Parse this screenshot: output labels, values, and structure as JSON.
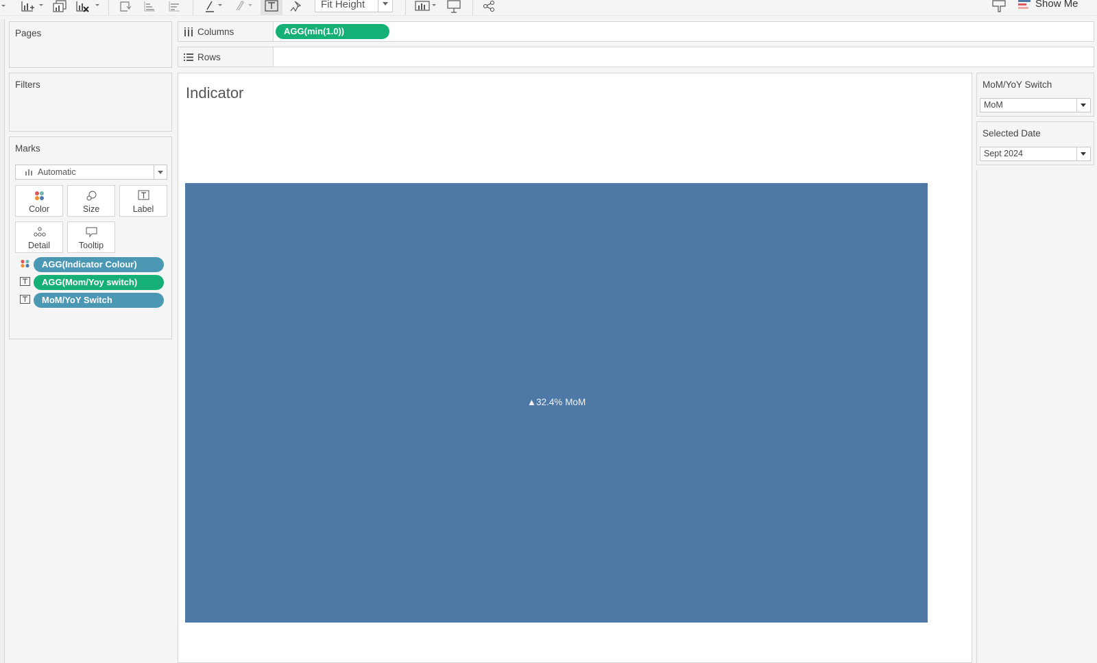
{
  "toolbar": {
    "fit_value": "Fit Height",
    "show_me_label": "Show Me",
    "icons": [
      "new-worksheet-icon",
      "new-dashboard-icon",
      "clear-sheet-icon",
      "swap-icon",
      "sort-ascending-icon",
      "sort-descending-icon",
      "highlight-icon",
      "annotate-icon",
      "show-mark-labels-icon",
      "pin-icon",
      "chart-type-icon",
      "presentation-icon",
      "share-icon",
      "tooltip-icon",
      "show-me-icon"
    ]
  },
  "pages": {
    "title": "Pages"
  },
  "filters": {
    "title": "Filters"
  },
  "marks": {
    "title": "Marks",
    "type": "Automatic",
    "buttons": [
      {
        "label": "Color"
      },
      {
        "label": "Size"
      },
      {
        "label": "Label"
      },
      {
        "label": "Detail"
      },
      {
        "label": "Tooltip"
      }
    ],
    "fields": [
      {
        "label": "AGG(Indicator Colour)",
        "kind": "color",
        "pill_color": "#4b98b5"
      },
      {
        "label": "AGG(Mom/Yoy switch)",
        "kind": "label",
        "pill_color": "#15b075"
      },
      {
        "label": "MoM/YoY Switch",
        "kind": "label",
        "pill_color": "#4b98b5"
      }
    ]
  },
  "shelves": {
    "columns": {
      "label": "Columns",
      "pill": "AGG(min(1.0))"
    },
    "rows": {
      "label": "Rows"
    }
  },
  "view": {
    "title": "Indicator",
    "bar_color": "#4e79a7",
    "bar_label": "▲32.4% MoM"
  },
  "parameters": {
    "mom_yoy": {
      "title": "MoM/YoY Switch",
      "value": "MoM"
    },
    "selected_date": {
      "title": "Selected Date",
      "value": "Sept 2024"
    }
  },
  "colors": {
    "green_pill": "#15b075",
    "blue_pill": "#4b98b5",
    "bar": "#4e79a7"
  }
}
